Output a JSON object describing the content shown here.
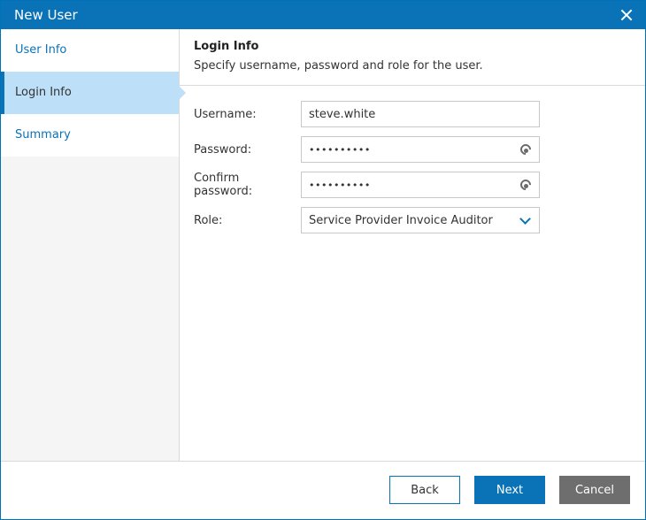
{
  "window": {
    "title": "New User"
  },
  "sidebar": {
    "items": [
      {
        "label": "User Info"
      },
      {
        "label": "Login Info"
      },
      {
        "label": "Summary"
      }
    ]
  },
  "main": {
    "section_title": "Login Info",
    "section_description": "Specify username, password and role for the user.",
    "fields": {
      "username": {
        "label": "Username:",
        "value": "steve.white"
      },
      "password": {
        "label": "Password:",
        "value": "••••••••••"
      },
      "confirm_password": {
        "label": "Confirm password:",
        "value": "••••••••••"
      },
      "role": {
        "label": "Role:",
        "value": "Service Provider Invoice Auditor"
      }
    }
  },
  "footer": {
    "back_label": "Back",
    "next_label": "Next",
    "cancel_label": "Cancel"
  },
  "colors": {
    "accent": "#0a73b7",
    "selected_nav_bg": "#bde0f8",
    "cancel_bg": "#6e6e6e"
  },
  "icons": {
    "close": "close-icon",
    "show_password": "eye-icon",
    "dropdown": "chevron-down-icon"
  }
}
